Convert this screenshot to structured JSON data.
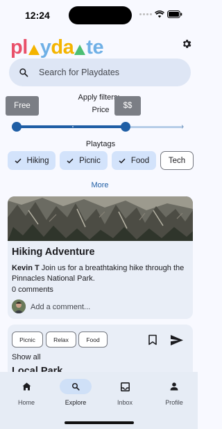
{
  "status_bar": {
    "time": "12:24"
  },
  "header": {
    "logo_letters": [
      {
        "char": "p",
        "color": "#e9506a"
      },
      {
        "char": "l",
        "color": "#e9506a"
      },
      {
        "char": "▲",
        "color": "#f4b400"
      },
      {
        "char": "y",
        "color": "#6fb0e6"
      },
      {
        "char": "d",
        "color": "#f4b400"
      },
      {
        "char": "a",
        "color": "#f4b400"
      },
      {
        "char": "▲",
        "color": "#4cbf73"
      },
      {
        "char": "t",
        "color": "#6fb0e6"
      },
      {
        "char": "e",
        "color": "#6fb0e6"
      }
    ],
    "settings_icon": "gear-icon"
  },
  "search": {
    "placeholder": "Search for Playdates",
    "icon": "search-icon"
  },
  "filters": {
    "title": "Apply filters:",
    "price": {
      "label": "Price",
      "min_label": "Free",
      "max_label": "$$",
      "range_low": 0,
      "range_high": 0.66
    },
    "playtags_title": "Playtags",
    "playtags": [
      {
        "label": "Hiking",
        "selected": true
      },
      {
        "label": "Picnic",
        "selected": true
      },
      {
        "label": "Food",
        "selected": true
      },
      {
        "label": "Tech",
        "selected": false
      }
    ],
    "more_label": "More"
  },
  "posts": [
    {
      "title": "Hiking Adventure",
      "author": "Kevin T",
      "body": " Join us for a breathtaking hike through the Pinnacles National Park.",
      "comments": "0 comments",
      "add_comment_placeholder": "Add a comment..."
    },
    {
      "tags": [
        "Picnic",
        "Relax",
        "Food"
      ],
      "show_all": "Show all",
      "title": "Local Park"
    }
  ],
  "nav": {
    "items": [
      {
        "label": "Home",
        "icon": "home-icon",
        "active": false
      },
      {
        "label": "Explore",
        "icon": "search-icon",
        "active": true
      },
      {
        "label": "Inbox",
        "icon": "inbox-icon",
        "active": false
      },
      {
        "label": "Profile",
        "icon": "person-icon",
        "active": false
      }
    ]
  },
  "colors": {
    "accent": "#1f5ea5",
    "chip_selected": "#d3e3fb",
    "search_bg": "#dee6f5"
  }
}
